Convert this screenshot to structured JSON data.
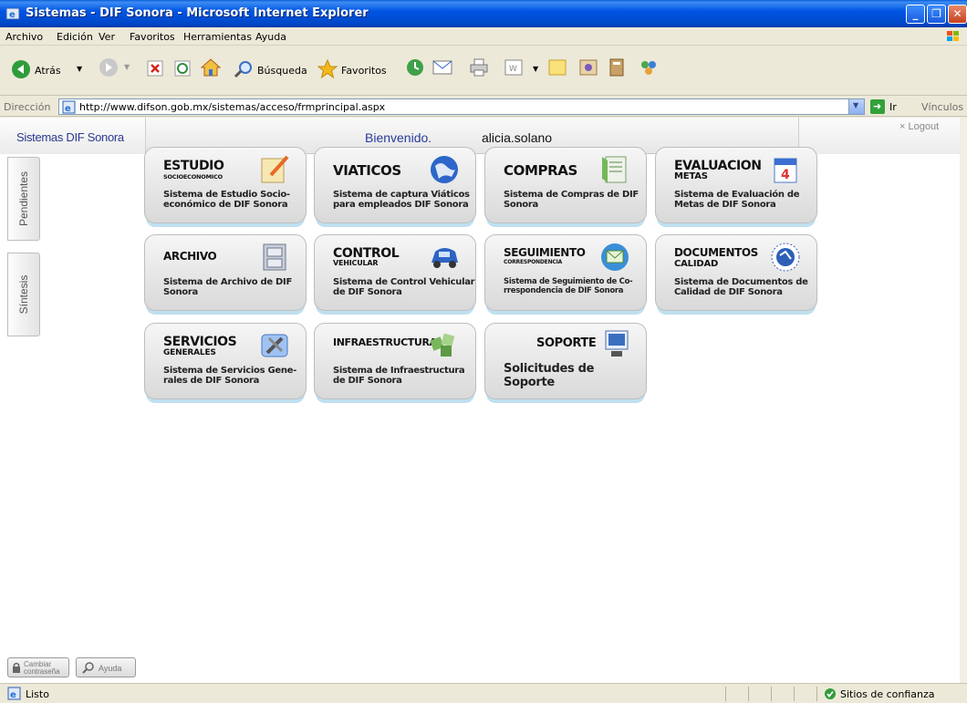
{
  "window": {
    "title": "Sistemas - DIF Sonora - Microsoft Internet Explorer"
  },
  "menu": [
    "Archivo",
    "Edición",
    "Ver",
    "Favoritos",
    "Herramientas",
    "Ayuda"
  ],
  "toolbar": {
    "back_label": "Atrás",
    "search_label": "Búsqueda",
    "favorites_label": "Favoritos"
  },
  "address": {
    "label": "Dirección",
    "url": "http://www.difson.gob.mx/sistemas/acceso/frmprincipal.aspx",
    "go_label": "Ir",
    "links_label": "Vínculos"
  },
  "header": {
    "brand": "Sistemas DIF Sonora",
    "welcome": "Bienvenido.",
    "user": "alicia.solano",
    "logout": "× Logout"
  },
  "side_tabs": {
    "pending": "Pendientes",
    "synthesis": "Síntesis"
  },
  "tiles": [
    {
      "title": "ESTUDIO",
      "subtitle": "SOCIOECONOMICO",
      "desc": "Sistema de Estudio Socio-económico de DIF Sonora",
      "icon": "notepad-icon"
    },
    {
      "title": "VIATICOS",
      "subtitle": "",
      "desc": "Sistema de captura Viáticos para empleados DIF Sonora",
      "icon": "globe-icon"
    },
    {
      "title": "COMPRAS",
      "subtitle": "",
      "desc": "Sistema de Compras de DIF Sonora",
      "icon": "document-icon"
    },
    {
      "title": "EVALUACION",
      "subtitle": "METAS",
      "desc": "Sistema de Evaluación de Metas de DIF Sonora",
      "icon": "calendar-icon"
    },
    {
      "title": "ARCHIVO",
      "subtitle": "",
      "desc": "Sistema de Archivo de DIF Sonora",
      "icon": "cabinet-icon"
    },
    {
      "title": "CONTROL",
      "subtitle": "VEHICULAR",
      "desc": "Sistema de Control Vehicular de DIF Sonora",
      "icon": "car-icon"
    },
    {
      "title": "SEGUIMIENTO",
      "subtitle": "CORRESPONDENCIA",
      "desc": "Sistema de Seguimiento de Co-rrespondencia de DIF Sonora",
      "icon": "mail-icon"
    },
    {
      "title": "DOCUMENTOS",
      "subtitle": "CALIDAD",
      "desc": "Sistema de Documentos de Calidad de DIF Sonora",
      "icon": "seal-icon"
    },
    {
      "title": "SERVICIOS",
      "subtitle": "GENERALES",
      "desc": "Sistema de Servicios Gene-rales de DIF Sonora",
      "icon": "tools-icon"
    },
    {
      "title": "INFRAESTRUCTURA",
      "subtitle": "",
      "desc": "Sistema de Infraestructura de DIF Sonora",
      "icon": "blocks-icon"
    },
    {
      "title": "SOPORTE",
      "subtitle": "",
      "desc": "Solicitudes de Soporte",
      "icon": "support-icon"
    }
  ],
  "bottom": {
    "change_password": "Cambiar contraseña",
    "help": "Ayuda"
  },
  "status": {
    "ready": "Listo",
    "zone": "Sitios de confianza"
  }
}
